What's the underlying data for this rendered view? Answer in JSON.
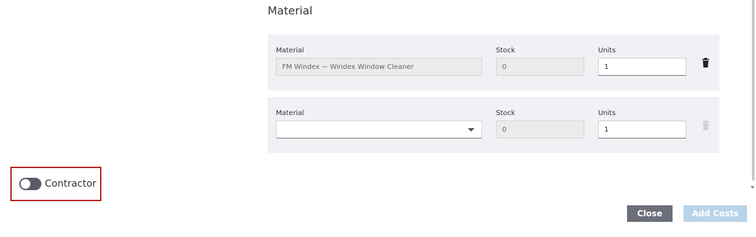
{
  "section": {
    "title": "Material"
  },
  "rows": [
    {
      "material_label": "Material",
      "stock_label": "Stock",
      "units_label": "Units",
      "material_value": "FM Windex ~ Windex Window Cleaner",
      "stock_value": "0",
      "units_value": "1",
      "delete_icon": "trash-icon",
      "delete_enabled": true
    },
    {
      "material_label": "Material",
      "stock_label": "Stock",
      "units_label": "Units",
      "material_value": "",
      "stock_value": "0",
      "units_value": "1",
      "delete_icon": "trash-icon",
      "delete_enabled": false
    }
  ],
  "contractor": {
    "label": "Contractor",
    "enabled": false
  },
  "footer": {
    "close_label": "Close",
    "add_costs_label": "Add Costs"
  },
  "colors": {
    "card_bg": "#f1f0f4",
    "highlight_border": "#b22222",
    "close_button": "#6c6e79",
    "add_costs_button_disabled": "#b9d3e8"
  }
}
